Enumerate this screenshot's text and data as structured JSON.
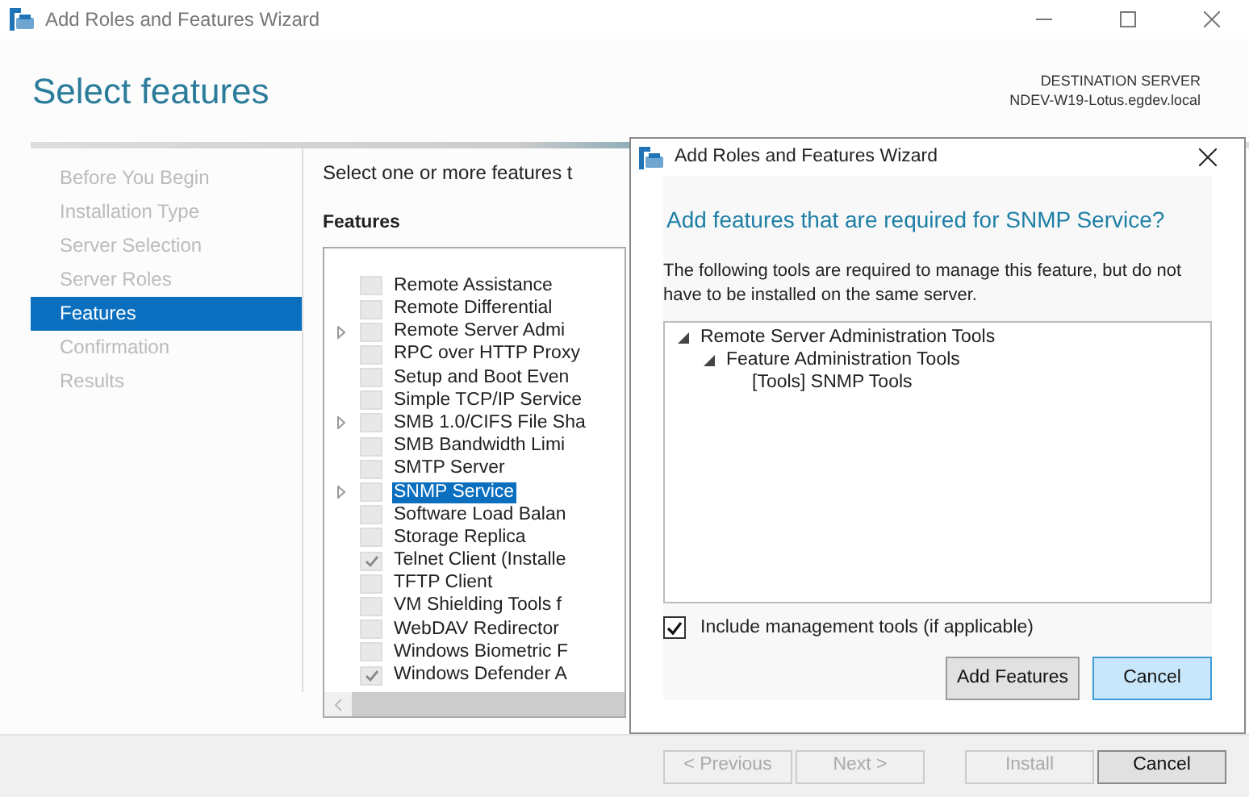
{
  "window": {
    "title": "Add Roles and Features Wizard"
  },
  "page_title": "Select features",
  "destination": {
    "label": "DESTINATION SERVER",
    "server": "NDEV-W19-Lotus.egdev.local"
  },
  "nav": [
    {
      "label": "Before You Begin",
      "selected": false
    },
    {
      "label": "Installation Type",
      "selected": false
    },
    {
      "label": "Server Selection",
      "selected": false
    },
    {
      "label": "Server Roles",
      "selected": false
    },
    {
      "label": "Features",
      "selected": true
    },
    {
      "label": "Confirmation",
      "selected": false
    },
    {
      "label": "Results",
      "selected": false
    }
  ],
  "intro": "Select one or more features t",
  "features_label": "Features",
  "features": [
    {
      "label": "Remote Assistance",
      "checked": false,
      "expandable": false,
      "selected": false
    },
    {
      "label": "Remote Differential",
      "checked": false,
      "expandable": false,
      "selected": false
    },
    {
      "label": "Remote Server Admi",
      "checked": false,
      "expandable": true,
      "selected": false
    },
    {
      "label": "RPC over HTTP Proxy",
      "checked": false,
      "expandable": false,
      "selected": false
    },
    {
      "label": "Setup and Boot Even",
      "checked": false,
      "expandable": false,
      "selected": false
    },
    {
      "label": "Simple TCP/IP Service",
      "checked": false,
      "expandable": false,
      "selected": false
    },
    {
      "label": "SMB 1.0/CIFS File Sha",
      "checked": false,
      "expandable": true,
      "selected": false
    },
    {
      "label": "SMB Bandwidth Limi",
      "checked": false,
      "expandable": false,
      "selected": false
    },
    {
      "label": "SMTP Server",
      "checked": false,
      "expandable": false,
      "selected": false
    },
    {
      "label": "SNMP Service",
      "checked": false,
      "expandable": true,
      "selected": true
    },
    {
      "label": "Software Load Balan",
      "checked": false,
      "expandable": false,
      "selected": false
    },
    {
      "label": "Storage Replica",
      "checked": false,
      "expandable": false,
      "selected": false
    },
    {
      "label": "Telnet Client (Installe",
      "checked": true,
      "expandable": false,
      "selected": false
    },
    {
      "label": "TFTP Client",
      "checked": false,
      "expandable": false,
      "selected": false
    },
    {
      "label": "VM Shielding Tools f",
      "checked": false,
      "expandable": false,
      "selected": false
    },
    {
      "label": "WebDAV Redirector",
      "checked": false,
      "expandable": false,
      "selected": false
    },
    {
      "label": "Windows Biometric F",
      "checked": false,
      "expandable": false,
      "selected": false
    },
    {
      "label": "Windows Defender A",
      "checked": true,
      "expandable": false,
      "selected": false
    }
  ],
  "dialog": {
    "title": "Add Roles and Features Wizard",
    "heading": "Add features that are required for SNMP Service?",
    "description": "The following tools are required to manage this feature, but do not have to be installed on the same server.",
    "tree": [
      {
        "label": "Remote Server Administration Tools",
        "expanded": true,
        "children": [
          {
            "label": "Feature Administration Tools",
            "expanded": true,
            "children": [
              {
                "label": "[Tools] SNMP Tools"
              }
            ]
          }
        ]
      }
    ],
    "include_tools": {
      "label": "Include management tools (if applicable)",
      "checked": true
    },
    "buttons": [
      {
        "label": "Add Features",
        "focused": false
      },
      {
        "label": "Cancel",
        "focused": true
      }
    ]
  },
  "footer_buttons": [
    {
      "label": "< Previous",
      "disabled": true
    },
    {
      "label": "Next >",
      "disabled": true
    },
    {
      "label": "Install",
      "disabled": true
    },
    {
      "label": "Cancel",
      "disabled": false
    }
  ]
}
